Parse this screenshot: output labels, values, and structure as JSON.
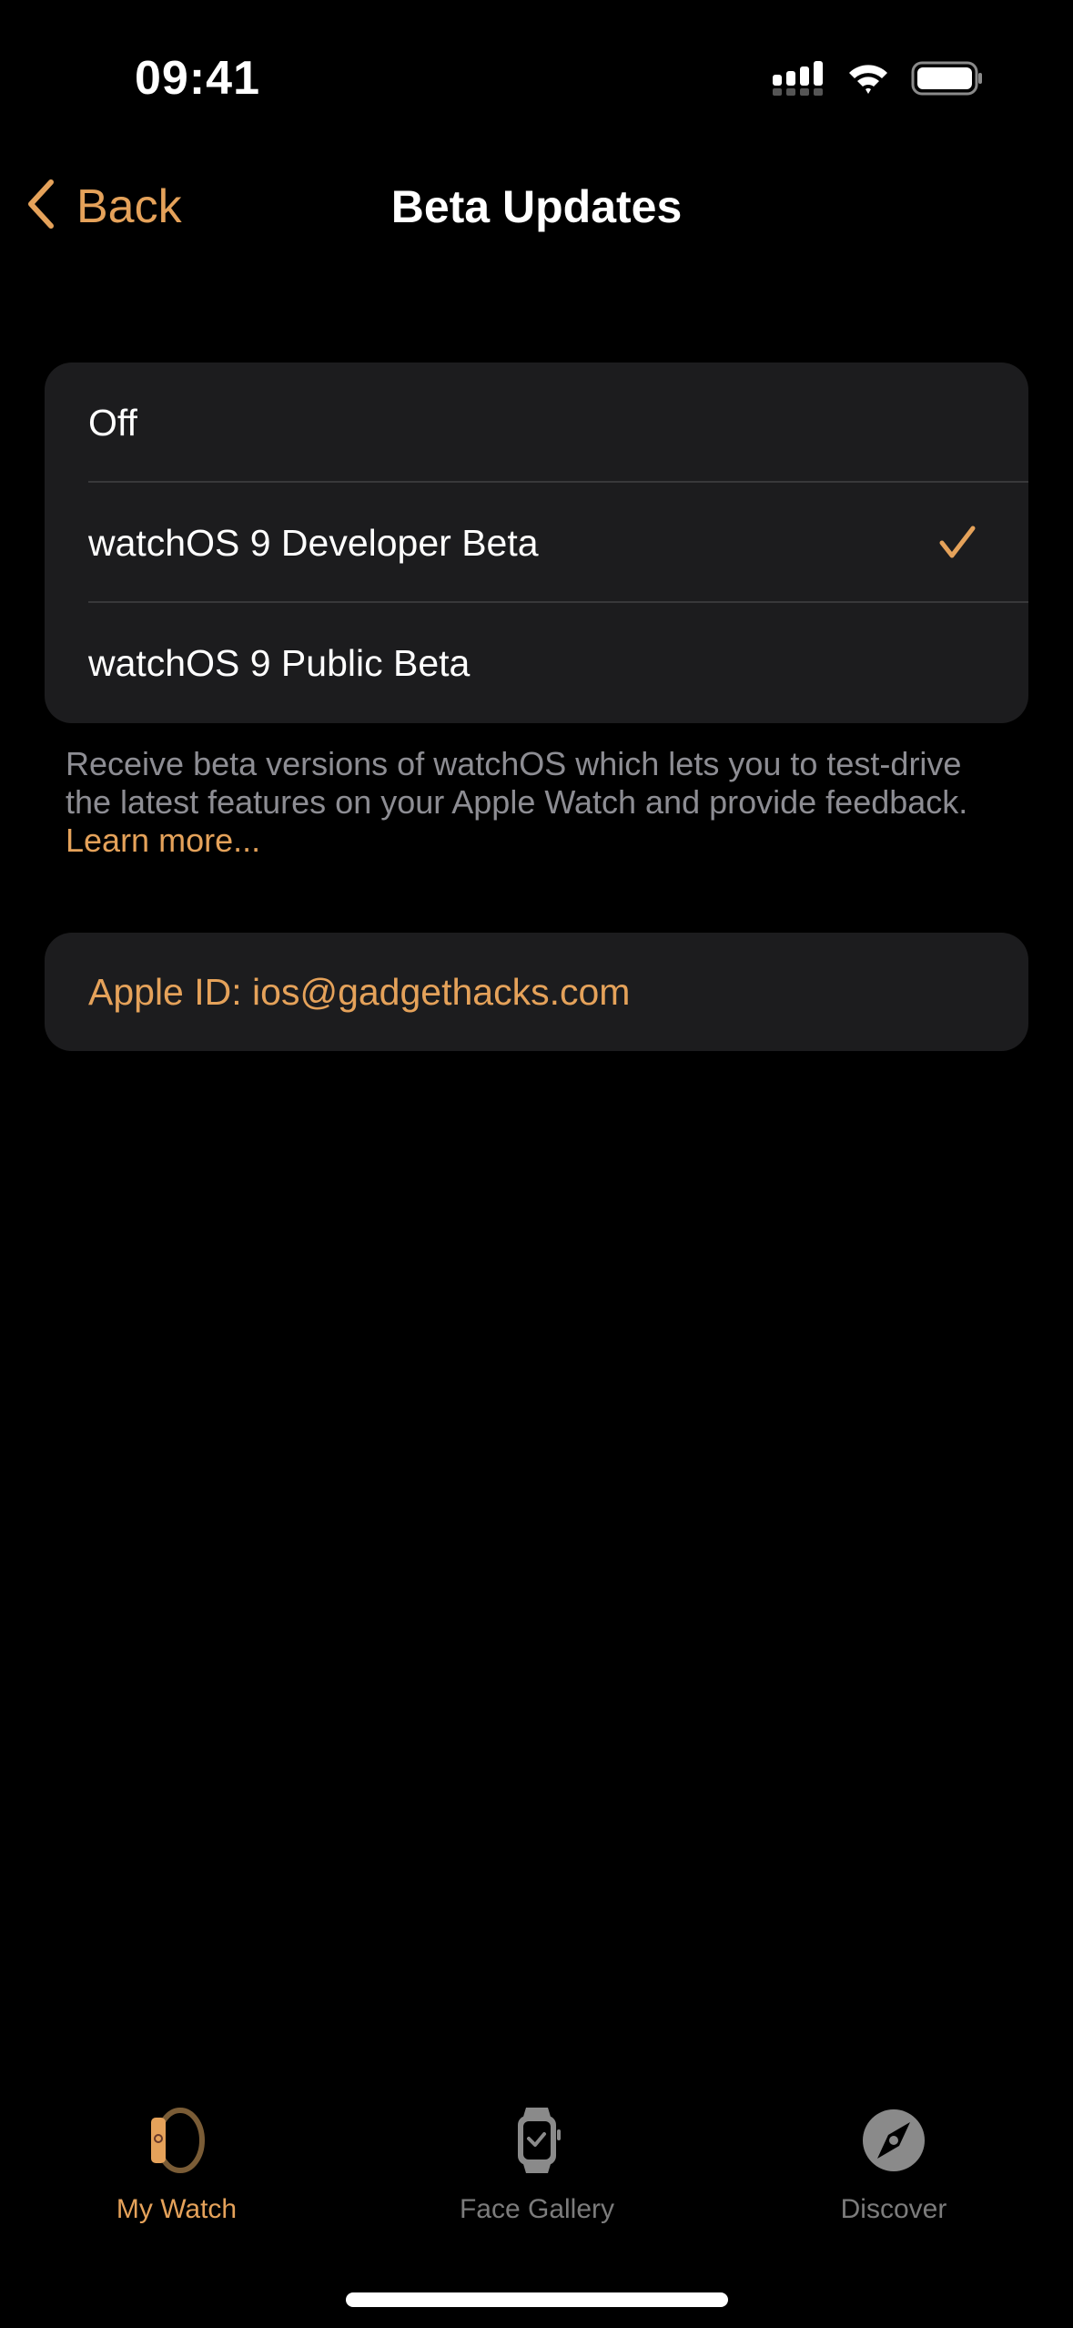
{
  "status_bar": {
    "time": "09:41",
    "icons": [
      "cellular-signal-icon",
      "wifi-icon",
      "battery-icon"
    ]
  },
  "nav": {
    "back_label": "Back",
    "title": "Beta Updates"
  },
  "beta_options": {
    "items": [
      {
        "label": "Off",
        "selected": false
      },
      {
        "label": "watchOS 9 Developer Beta",
        "selected": true
      },
      {
        "label": "watchOS 9 Public Beta",
        "selected": false
      }
    ]
  },
  "footer": {
    "text": "Receive beta versions of watchOS which lets you to test-drive the latest features on your Apple Watch and provide feedback.",
    "link": "Learn more..."
  },
  "apple_id": {
    "label": "Apple ID: ios@gadgethacks.com"
  },
  "tab_bar": {
    "tabs": [
      {
        "label": "My Watch",
        "icon": "my-watch-icon",
        "active": true
      },
      {
        "label": "Face Gallery",
        "icon": "face-gallery-icon",
        "active": false
      },
      {
        "label": "Discover",
        "icon": "discover-compass-icon",
        "active": false
      }
    ]
  },
  "colors": {
    "accent": "#e5a25a",
    "background": "#000000",
    "group_background": "#1c1c1e",
    "secondary_text": "#8d8d93",
    "inactive_tab": "#7c7c7c"
  }
}
